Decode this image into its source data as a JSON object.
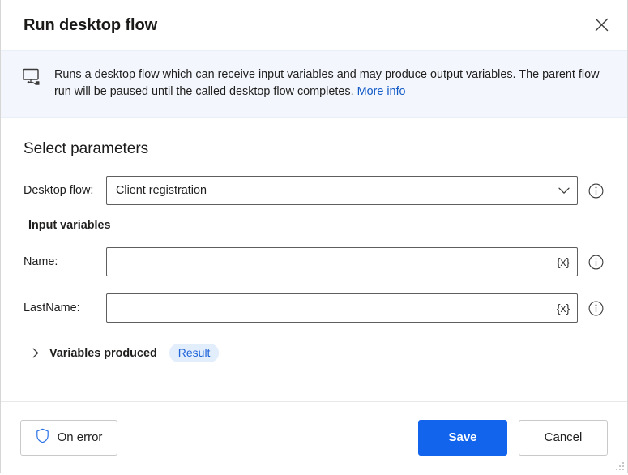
{
  "dialog": {
    "title": "Run desktop flow",
    "close_label": "Close"
  },
  "banner": {
    "icon": "desktop-flow-icon",
    "text": "Runs a desktop flow which can receive input variables and may produce output variables. The parent flow run will be paused until the called desktop flow completes.",
    "link_label": "More info"
  },
  "main": {
    "section_title": "Select parameters",
    "desktop_flow": {
      "label": "Desktop flow:",
      "value": "Client registration",
      "placeholder": "",
      "chevron_icon": "chevron-down-icon",
      "info_icon": "info-icon"
    },
    "input_variables": {
      "title": "Input variables",
      "fields": [
        {
          "label": "Name:",
          "value": "",
          "placeholder": "",
          "variable_glyph": "{x}",
          "info_icon": "info-icon"
        },
        {
          "label": "LastName:",
          "value": "",
          "placeholder": "",
          "variable_glyph": "{x}",
          "info_icon": "info-icon"
        }
      ]
    },
    "variables_produced": {
      "expander_icon": "chevron-right-icon",
      "label": "Variables produced",
      "badge": "Result"
    }
  },
  "footer": {
    "on_error_label": "On error",
    "on_error_icon": "shield-icon",
    "save_label": "Save",
    "cancel_label": "Cancel"
  },
  "colors": {
    "accent": "#1264ec",
    "link": "#1359c6",
    "banner_bg": "#f3f7fd",
    "badge_bg": "#e3eefc",
    "badge_text": "#1f64d8",
    "shield": "#2a72e5",
    "border": "#605e5c"
  }
}
